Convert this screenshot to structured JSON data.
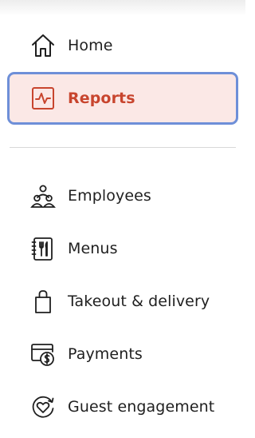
{
  "nav": {
    "top_items": [
      {
        "label": "Home",
        "icon": "home-icon"
      },
      {
        "label": "Reports",
        "icon": "reports-icon",
        "active": true
      }
    ],
    "items": [
      {
        "label": "Employees",
        "icon": "employees-icon"
      },
      {
        "label": "Menus",
        "icon": "menus-icon"
      },
      {
        "label": "Takeout & delivery",
        "icon": "shopping-bag-icon"
      },
      {
        "label": "Payments",
        "icon": "payments-icon"
      },
      {
        "label": "Guest engagement",
        "icon": "guest-engagement-icon"
      }
    ]
  },
  "colors": {
    "active_background": "#fbe8e6",
    "active_text": "#c8452e",
    "focus_ring": "#6e8fd8",
    "text": "#1f1f1f"
  }
}
